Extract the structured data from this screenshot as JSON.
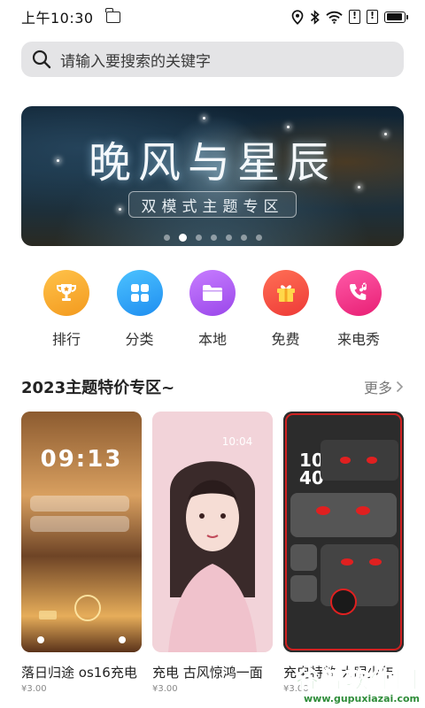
{
  "status_bar": {
    "time": "上午10:30",
    "battery_level": 0.9,
    "alert_glyph": "!"
  },
  "search": {
    "placeholder": "请输入要搜索的关键字"
  },
  "banner": {
    "title": "晚风与星辰",
    "subtitle": "双模式主题专区",
    "page_count": 7,
    "active_index": 1
  },
  "categories": [
    {
      "label": "排行",
      "icon": "trophy-icon",
      "color": "#f6a92c"
    },
    {
      "label": "分类",
      "icon": "grid-icon",
      "color": "#2aa0f0"
    },
    {
      "label": "本地",
      "icon": "folder-icon",
      "color": "#b35df0"
    },
    {
      "label": "免费",
      "icon": "gift-icon",
      "color": "#f2503e"
    },
    {
      "label": "来电秀",
      "icon": "phone-music-icon",
      "color": "#f23b88"
    }
  ],
  "section": {
    "title": "2023主题特价专区~",
    "more": "更多"
  },
  "cards": [
    {
      "name": "落日归途 os16充电",
      "price": "¥3.00",
      "preview_time": "09:13"
    },
    {
      "name": "充电 古风惊鸿一面",
      "price": "¥3.00",
      "preview_time": "10:04"
    },
    {
      "name": "充电特效 大眼少年",
      "price": "¥3.00",
      "preview_time": "10:40"
    }
  ],
  "watermark": {
    "main": "谷普软件园",
    "url": "www.gupuxiazai.com"
  }
}
